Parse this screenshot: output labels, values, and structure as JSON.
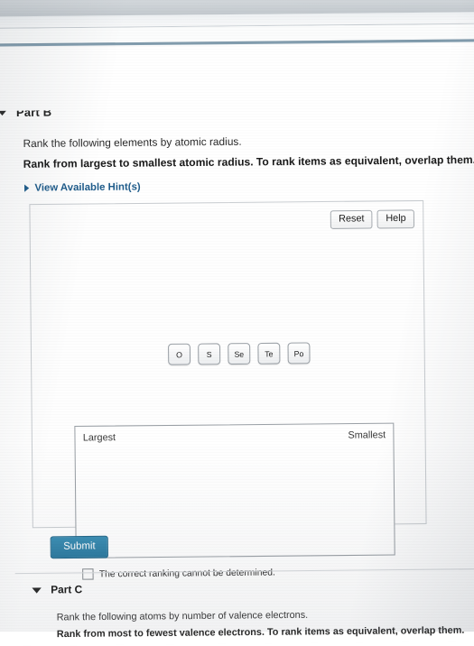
{
  "browser": {
    "chrome_label": ""
  },
  "part_b": {
    "title": "Part B",
    "prompt_line1": "Rank the following elements by atomic radius.",
    "prompt_line2": "Rank from largest to smallest atomic radius. To rank items as equivalent, overlap them.",
    "hints_label": "View Available Hint(s)",
    "reset_label": "Reset",
    "help_label": "Help",
    "tiles": [
      "O",
      "S",
      "Se",
      "Te",
      "Po"
    ],
    "dropzone": {
      "left_label": "Largest",
      "right_label": "Smallest"
    },
    "cannot_determine_label": "The correct ranking cannot be determined.",
    "submit_label": "Submit"
  },
  "part_c": {
    "title": "Part C",
    "prompt_line1": "Rank the following atoms by number of valence electrons.",
    "prompt_line2": "Rank from most to fewest valence electrons. To rank items as equivalent, overlap them."
  },
  "icons": {
    "collapse": "caret-down-icon",
    "expand": "caret-right-icon"
  },
  "colors": {
    "link": "#1f5c8b",
    "submit": "#2d7ba0",
    "chrome": "#cfd4d8"
  }
}
